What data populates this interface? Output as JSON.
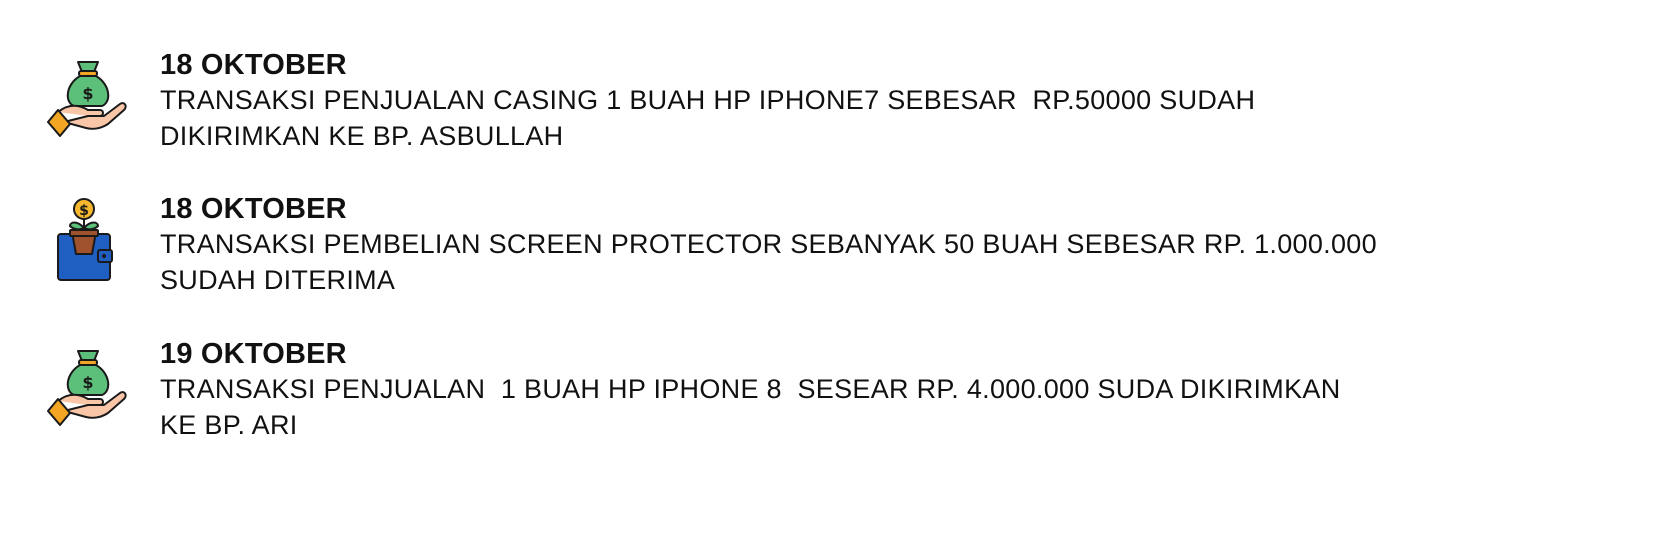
{
  "transactions": [
    {
      "icon": "money-bag-hand-icon",
      "date": "18 OKTOBER",
      "line1": "TRANSAKSI PENJUALAN CASING 1 BUAH HP IPHONE7 SEBESAR  RP.50000 SUDAH",
      "line2": "DIKIRIMKAN KE BP. ASBULLAH"
    },
    {
      "icon": "wallet-money-plant-icon",
      "date": "18 OKTOBER",
      "line1": "TRANSAKSI PEMBELIAN SCREEN PROTECTOR SEBANYAK 50 BUAH SEBESAR RP. 1.000.000",
      "line2": "SUDAH DITERIMA"
    },
    {
      "icon": "money-bag-hand-icon",
      "date": "19 OKTOBER",
      "line1": "TRANSAKSI PENJUALAN  1 BUAH HP IPHONE 8  SESEAR RP. 4.000.000 SUDA DIKIRIMKAN",
      "line2": "KE BP. ARI"
    }
  ],
  "colors": {
    "bag_green": "#5cbf7a",
    "hand_skin": "#f9c6a8",
    "sleeve_orange": "#f3a623",
    "wallet_blue": "#1f5fc2",
    "pot_brown": "#a0522d",
    "coin_gold": "#f5b82e",
    "outline": "#1a1a1a"
  }
}
